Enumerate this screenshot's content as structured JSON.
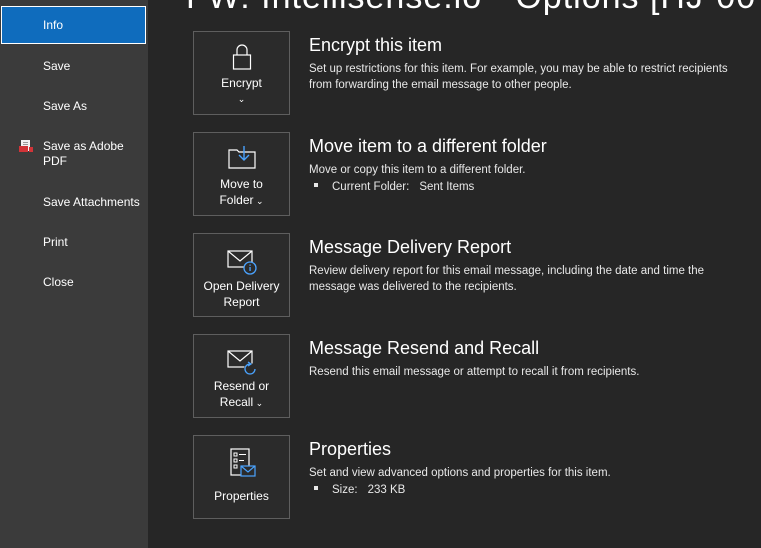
{
  "title": "FW: Intellisense.io - Options [HJ-00",
  "sidebar": {
    "items": [
      {
        "label": "Info"
      },
      {
        "label": "Save"
      },
      {
        "label": "Save As"
      },
      {
        "label": "Save as Adobe PDF"
      },
      {
        "label": "Save Attachments"
      },
      {
        "label": "Print"
      },
      {
        "label": "Close"
      }
    ]
  },
  "sections": [
    {
      "button_label": "Encrypt",
      "heading": "Encrypt this item",
      "description": "Set up restrictions for this item. For example, you may be able to restrict recipients from forwarding the email message to other people.",
      "icon": "lock-icon"
    },
    {
      "button_label_1": "Move to",
      "button_label_2": "Folder",
      "heading": "Move item to a different folder",
      "description": "Move or copy this item to a different folder.",
      "bullet_label": "Current Folder:",
      "bullet_value": "Sent Items",
      "icon": "move-folder-icon"
    },
    {
      "button_label_1": "Open Delivery",
      "button_label_2": "Report",
      "heading": "Message Delivery Report",
      "description": "Review delivery report for this email message, including the date and time the message was delivered to the recipients.",
      "icon": "envelope-info-icon"
    },
    {
      "button_label_1": "Resend or",
      "button_label_2": "Recall",
      "heading": "Message Resend and Recall",
      "description": "Resend this email message or attempt to recall it from recipients.",
      "icon": "envelope-resend-icon"
    },
    {
      "button_label": "Properties",
      "heading": "Properties",
      "description": "Set and view advanced options and properties for this item.",
      "bullet_label": "Size:",
      "bullet_value": "233 KB",
      "icon": "properties-icon"
    }
  ],
  "colors": {
    "accent": "#0f6cbd",
    "sidebar_bg": "#3b3b3b",
    "main_bg": "#262626"
  }
}
